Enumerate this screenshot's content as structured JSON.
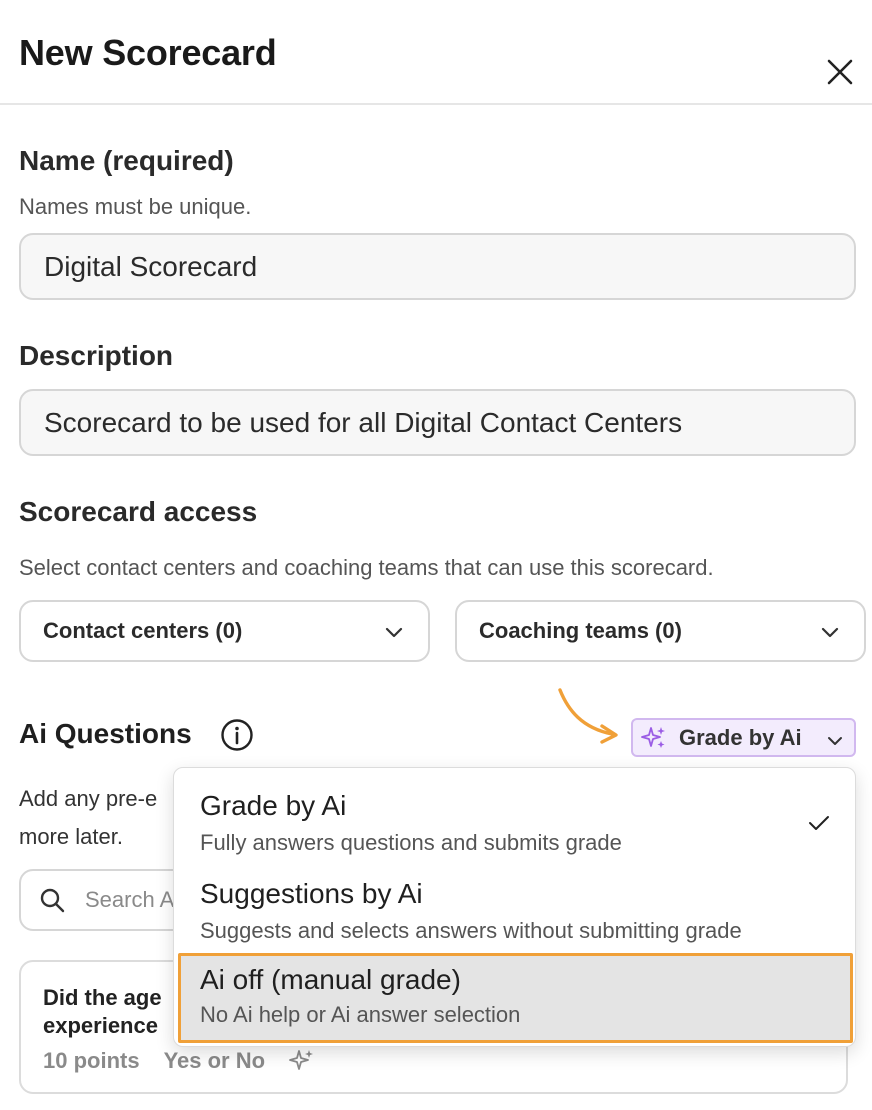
{
  "header": {
    "title": "New Scorecard",
    "close_icon": "close-icon"
  },
  "name": {
    "label": "Name (required)",
    "helper": "Names must be unique.",
    "value": "Digital Scorecard"
  },
  "description": {
    "label": "Description",
    "value": "Scorecard to be used for all Digital Contact Centers"
  },
  "access": {
    "label": "Scorecard access",
    "helper": "Select contact centers and coaching teams that can use this scorecard.",
    "contact_centers": "Contact centers (0)",
    "coaching_teams": "Coaching teams (0)"
  },
  "ai_questions": {
    "title": "Ai Questions",
    "info_icon": "info-icon",
    "grade_button": "Grade by Ai",
    "add_text_line1": "Add any pre-e",
    "add_text_line2": "more later.",
    "search_placeholder": "Search A"
  },
  "dropdown": {
    "options": [
      {
        "title": "Grade by Ai",
        "desc": "Fully answers questions and submits grade",
        "checked": true
      },
      {
        "title": "Suggestions by Ai",
        "desc": "Suggests and selects answers without submitting grade",
        "checked": false
      },
      {
        "title": "Ai off (manual grade)",
        "desc": "No Ai help or Ai answer selection",
        "checked": false,
        "highlighted": true
      }
    ]
  },
  "question_card": {
    "text_line1": "Did the age",
    "text_line2": "experience",
    "points": "10 points",
    "type": "Yes or No"
  },
  "colors": {
    "accent_purple": "#9b5de5",
    "highlight_orange": "#f0a038",
    "arrow_orange": "#f0a038"
  }
}
